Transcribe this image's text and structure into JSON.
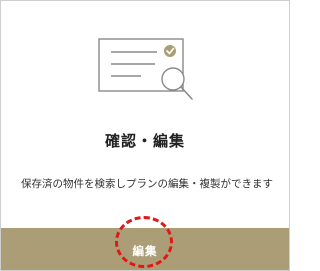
{
  "card": {
    "title": "確認・編集",
    "description": "保存済の物件を検索しプランの編集・複製ができます",
    "illustration_icon": "document-search-icon",
    "edit_button_label": "編集",
    "button_color": "#ab9e77",
    "highlight_color": "#e01818"
  }
}
